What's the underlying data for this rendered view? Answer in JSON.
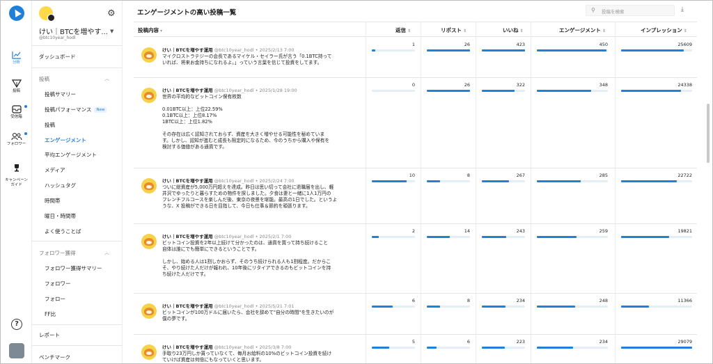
{
  "rail": {
    "items": [
      {
        "label": "分析",
        "icon": "chart-line-icon"
      },
      {
        "label": "投稿",
        "icon": "send-icon"
      },
      {
        "label": "受信箱",
        "icon": "inbox-icon"
      },
      {
        "label": "フォロワー",
        "icon": "people-icon"
      },
      {
        "label": "キャンペーン\nガイド",
        "icon": "trophy-icon"
      }
    ],
    "help": "?"
  },
  "account": {
    "name": "けい｜BTCを増やす...",
    "handle": "@btc10year_hodl"
  },
  "sidebar": {
    "dashboard": "ダッシュボード",
    "posts_section": "投稿",
    "posts_items": [
      "投稿サマリー",
      "投稿パフォーマンス",
      "投稿",
      "エンゲージメント",
      "平均エンゲージメント",
      "メディア",
      "ハッシュタグ",
      "時間帯",
      "曜日・時間帯",
      "よく使うことば"
    ],
    "new_badge": "New",
    "followers_section": "フォロワー獲得",
    "followers_items": [
      "フォロワー獲得サマリー",
      "フォロワー",
      "フォロー",
      "FF比"
    ],
    "report": "レポート",
    "benchmark": "ベンチマーク"
  },
  "main": {
    "title": "エンゲージメントの高い投稿一覧",
    "search_placeholder": "投稿を検索"
  },
  "table": {
    "columns": [
      "投稿内容",
      "返信",
      "リポスト",
      "いいね",
      "エンゲージメント",
      "インプレッション"
    ],
    "author": "けい｜BTCを増やす運用",
    "handle": "@btc10year_hodl",
    "rows": [
      {
        "date": "2025/2/13 7:00",
        "text": "マイクロストラテジーの会長であるマイケル・セイラー氏が言う「0.1BTC持って\nいれば、将来お金持ちになれるよ。」っていう言葉を信じて投資をしてます。",
        "reply": 1,
        "repost": 26,
        "like": 423,
        "engagement": 450,
        "impression": 25609,
        "bars": [
          0.08,
          1,
          1,
          0.98,
          0.88
        ]
      },
      {
        "date": "2025/1/28 19:00",
        "text": "世界の平均的なビットコイン保有枚数\n\n0.01BTC以上：上位22.59%\n0.1BTC以上：上位8.17%\n1BTC以上：上位1.82%\n\nその存在は広く認知されておらず、資産を大きく増やせる可能性を秘めていま\nす。しかし、認知が進むと成長も限定的になるため、今のうちから購入や保有を\n検討する価値がある通貨です。",
        "reply": 0,
        "repost": 26,
        "like": 322,
        "engagement": 348,
        "impression": 24338,
        "bars": [
          0,
          1,
          0.76,
          0.76,
          0.84
        ]
      },
      {
        "date": "2025/2/24 7:00",
        "text": "ついに総資産が5,000万円超えを達成。昨日は思い切って会社に退職届を出し、軽\n井沢でゆったりと暮らすための物件を探しました。夕食は妻と一緒に1人1万円の\nフレンチフルコースを楽しんだ後、東京の夜景を堪能。最高の1日でした。というよ\nうな、X 投稿ができる日を目指して、今日も仕事＆節約を頑張ります。",
        "reply": 10,
        "repost": 8,
        "like": 267,
        "engagement": 285,
        "impression": 22722,
        "bars": [
          0.8,
          0.31,
          0.63,
          0.62,
          0.78
        ]
      },
      {
        "date": "2025/2/1 7:00",
        "text": "ビットコイン投資を2年以上続けて分かったのは、通貨を買って持ち続けること\n自体は誰にでも簡単にできるということです。\n\nしかし、始める人は1割しかおらず、そのうち続けられる人も1割程度。だからこ\nそ、やり続けた人だけが報われ、10年後にリタイアできるのもビットコインを持\nち続けた人だけです。",
        "reply": 2,
        "repost": 14,
        "like": 243,
        "engagement": 259,
        "impression": 19821,
        "bars": [
          0.16,
          0.54,
          0.57,
          0.56,
          0.68
        ]
      },
      {
        "date": "2025/5/21 7:01",
        "text": "ビットコインが100万ドルに届いたら、会社を辞めて\"自分の時間\"を生きたいのが\n僕の夢です。",
        "reply": 6,
        "repost": 8,
        "like": 234,
        "engagement": 248,
        "impression": 11366,
        "bars": [
          0.48,
          0.31,
          0.55,
          0.54,
          0.39
        ]
      },
      {
        "date": "2025/3/8 7:00",
        "text": "手取り23万円しか貰っていなくて、毎月お給料の10%のビットコイン投資を続け\nていけば資産は何倍にもなっていくと思います。",
        "reply": 5,
        "repost": 6,
        "like": 223,
        "engagement": 234,
        "impression": 29079,
        "bars": [
          0.4,
          0.23,
          0.53,
          0.51,
          1
        ]
      }
    ]
  },
  "colors": {
    "accent": "#1f7fd9",
    "bar_track": "#e4eef8"
  }
}
